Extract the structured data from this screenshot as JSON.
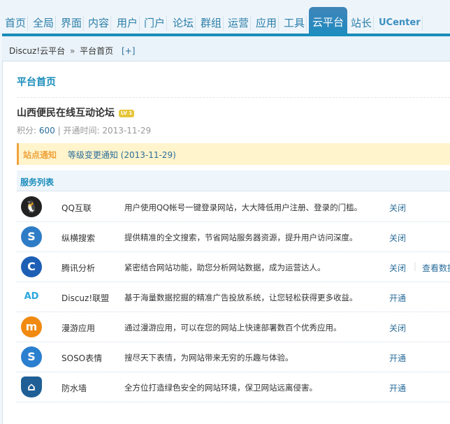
{
  "nav": {
    "tabs": [
      "首页",
      "全局",
      "界面",
      "内容",
      "用户",
      "门户",
      "论坛",
      "群组",
      "运营",
      "应用",
      "工具",
      "云平台",
      "站长",
      "UCenter"
    ],
    "active": "云平台"
  },
  "breadcrumb": {
    "root": "Discuz!云平台",
    "sep": "»",
    "current": "平台首页",
    "add": "[+]"
  },
  "main": {
    "title": "平台首页",
    "forum_name": "山西便民在线互动论坛",
    "level_badge": "LV 1",
    "score_label": "积分:",
    "score": "600",
    "divider": "|",
    "open_label": "开通时间:",
    "open_date": "2013-11-29",
    "notice_label": "站点通知",
    "notice_text": "等级变更通知 (2013-11-29)",
    "services_title": "服务列表",
    "services": [
      {
        "icon": "qq-penguin-icon",
        "name": "QQ互联",
        "desc": "用户使用QQ帐号一键登录网站，大大降低用户注册、登录的门槛。",
        "action": "关闭",
        "color": "#222"
      },
      {
        "icon": "search-s-icon",
        "name": "纵横搜索",
        "desc": "提供精准的全文搜索，节省网站服务器资源，提升用户访问深度。",
        "action": "关闭",
        "color": "#2e7cc6"
      },
      {
        "icon": "analytics-icon",
        "name": "腾讯分析",
        "desc": "紧密结合网站功能，助您分析网站数据，成为运营达人。",
        "action": "关闭",
        "extra": "查看数据",
        "color": "#1d5fb5"
      },
      {
        "icon": "ad-icon",
        "name": "Discuz!联盟",
        "desc": "基于海量数据挖掘的精准广告投放系统，让您轻松获得更多收益。",
        "action": "开通",
        "color": "#2aa6e0"
      },
      {
        "icon": "manyou-icon",
        "name": "漫游应用",
        "desc": "通过漫游应用，可以在您的网站上快速部署数百个优秀应用。",
        "action": "关闭",
        "color": "#f08a10"
      },
      {
        "icon": "soso-smiley-icon",
        "name": "SOSO表情",
        "desc": "搜尽天下表情，为网站带来无穷的乐趣与体验。",
        "action": "开通",
        "color": "#2b7fcf"
      },
      {
        "icon": "shield-icon",
        "name": "防水墙",
        "desc": "全方位打造绿色安全的网站环境，保卫网站远离侵害。",
        "action": "开通",
        "color": "#1f5f96"
      }
    ]
  }
}
